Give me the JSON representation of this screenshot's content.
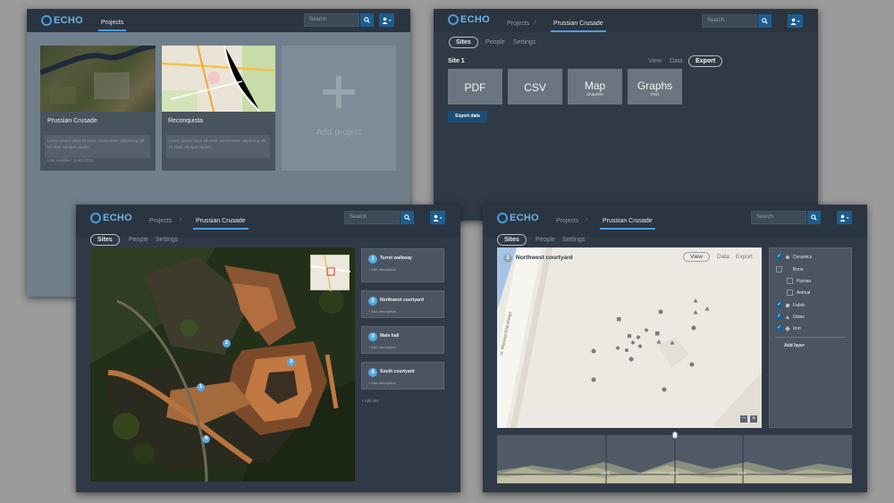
{
  "brand": {
    "name": "ECHO"
  },
  "header": {
    "search_placeholder": "Search"
  },
  "nav": {
    "projects": "Projects",
    "current_project": "Prussian Crusade"
  },
  "tabs": {
    "sites": "Sites",
    "people": "People",
    "settings": "Settings"
  },
  "projects_window": {
    "cards": [
      {
        "title": "Prussian Crusade",
        "description": "Lorem ipsum dolor sit amet, consectetur adipiscing elit. Ut vitae volutpat sapien.",
        "modified": "Last modified 12-03-2013"
      },
      {
        "title": "Reconquista",
        "description": "Lorem ipsum dolor sit amet, consectetur adipiscing elit. Ut vitae volutpat sapien."
      }
    ],
    "add_label": "Add project"
  },
  "export_window": {
    "site_label": "Site 1",
    "mode_view": "View",
    "mode_data": "Data",
    "mode_export": "Export",
    "formats": [
      {
        "label": "PDF",
        "sub": ""
      },
      {
        "label": "CSV",
        "sub": ""
      },
      {
        "label": "Map",
        "sub": "Shapefile"
      },
      {
        "label": "Graphs",
        "sub": "PNG"
      }
    ],
    "export_button": "Export data"
  },
  "sites_window": {
    "sites": [
      {
        "num": "1",
        "title": "Turret walkway",
        "sub": "+ Add description"
      },
      {
        "num": "2",
        "title": "Northwest courtyard",
        "sub": "+ Add description"
      },
      {
        "num": "3",
        "title": "Main hall",
        "sub": "+ Add description"
      },
      {
        "num": "4",
        "title": "South courtyard",
        "sub": "+ Add description"
      }
    ],
    "add_site": "+ Add site",
    "markers": [
      "1",
      "2",
      "3",
      "4"
    ]
  },
  "map_window": {
    "site_num": "2",
    "site_title": "Northwest courtyard",
    "mode_view": "View",
    "mode_data": "Data",
    "mode_export": "Export",
    "street_label": "ul. Macieja Kilarskiego",
    "layers": [
      {
        "label": "Ceramics",
        "checked": true,
        "indent": false
      },
      {
        "label": "Bone",
        "checked": false,
        "indent": false
      },
      {
        "label": "Human",
        "checked": false,
        "indent": true
      },
      {
        "label": "Animal",
        "checked": false,
        "indent": true
      },
      {
        "label": "Fabric",
        "checked": true,
        "indent": false
      },
      {
        "label": "Glass",
        "checked": true,
        "indent": false
      },
      {
        "label": "Iron",
        "checked": true,
        "indent": false
      }
    ],
    "add_layer": "Add layer",
    "timeline_ticks": [
      "1300",
      "1350",
      "1400"
    ]
  }
}
